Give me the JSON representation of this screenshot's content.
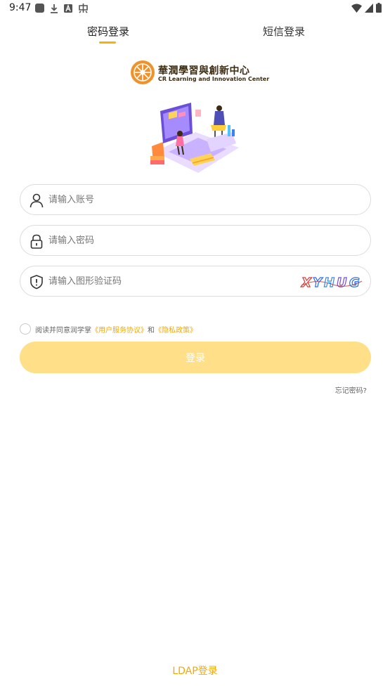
{
  "status_bar": {
    "time": "9:47",
    "left_icons": [
      "app-square-icon",
      "download-icon",
      "a-badge-icon",
      "chinese-char-icon"
    ],
    "right_icons": [
      "wifi-icon",
      "signal-icon",
      "battery-icon"
    ]
  },
  "tabs": [
    {
      "label": "密码登录",
      "active": true
    },
    {
      "label": "短信登录",
      "active": false
    }
  ],
  "logo": {
    "title": "華潤學習與創新中心",
    "subtitle": "CR Learning and Innovation Center"
  },
  "form": {
    "account_placeholder": "请输入账号",
    "password_placeholder": "请输入密码",
    "captcha_placeholder": "请输入图形验证码",
    "captcha_text": "XYHUG"
  },
  "agreement": {
    "prefix": "阅读并同意润学掌",
    "user_agreement": "《用户服务协议》",
    "conjunction": "和",
    "privacy_policy": "《隐私政策》"
  },
  "login_button": "登录",
  "forgot_password": "忘记密码?",
  "ldap_login": "LDAP登录",
  "colors": {
    "accent": "#f5a800",
    "button_bg": "#ffdf88",
    "tab_underline": "#f5b30a"
  }
}
